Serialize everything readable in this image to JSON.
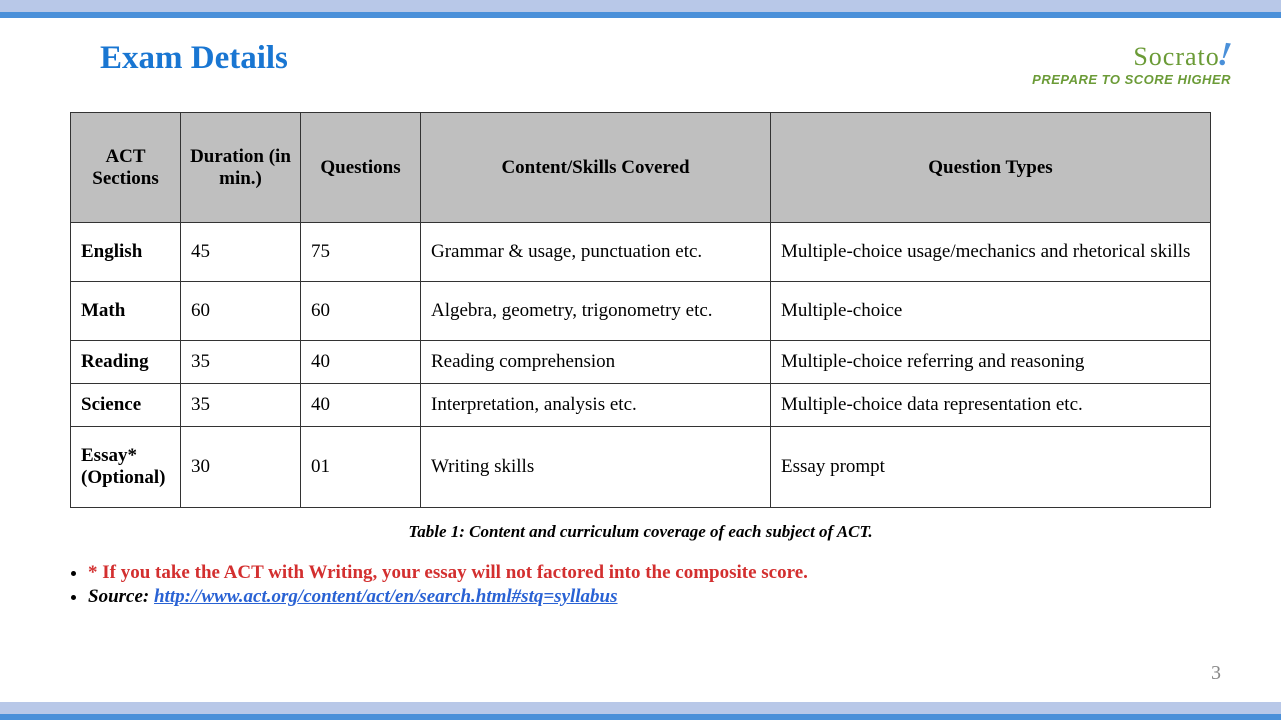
{
  "title": "Exam Details",
  "logo": {
    "main": "Socrato",
    "exclamation": "!",
    "tagline": "PREPARE TO SCORE HIGHER"
  },
  "table": {
    "headers": {
      "section": "ACT Sections",
      "duration": "Duration (in min.)",
      "questions": "Questions",
      "content": "Content/Skills  Covered",
      "types": "Question  Types"
    },
    "rows": [
      {
        "section": "English",
        "duration": "45",
        "questions": "75",
        "content": "Grammar & usage, punctuation etc.",
        "types": "Multiple-choice usage/mechanics and rhetorical skills"
      },
      {
        "section": "Math",
        "duration": "60",
        "questions": "60",
        "content": "Algebra, geometry, trigonometry etc.",
        "types": "Multiple-choice"
      },
      {
        "section": "Reading",
        "duration": "35",
        "questions": "40",
        "content": "Reading comprehension",
        "types": "Multiple-choice referring and reasoning"
      },
      {
        "section": "Science",
        "duration": "35",
        "questions": "40",
        "content": "Interpretation, analysis etc.",
        "types": "Multiple-choice data representation etc."
      },
      {
        "section": "Essay* (Optional)",
        "duration": "30",
        "questions": "01",
        "content": "Writing skills",
        "types": "Essay prompt"
      }
    ]
  },
  "caption": "Table 1: Content and curriculum coverage of each subject of ACT.",
  "notes": {
    "warning": "* If you take the ACT with Writing, your essay will not factored into the composite score.",
    "source_label": " Source: ",
    "source_url": "http://www.act.org/content/act/en/search.html#stq=syllabus"
  },
  "page_number": "3"
}
